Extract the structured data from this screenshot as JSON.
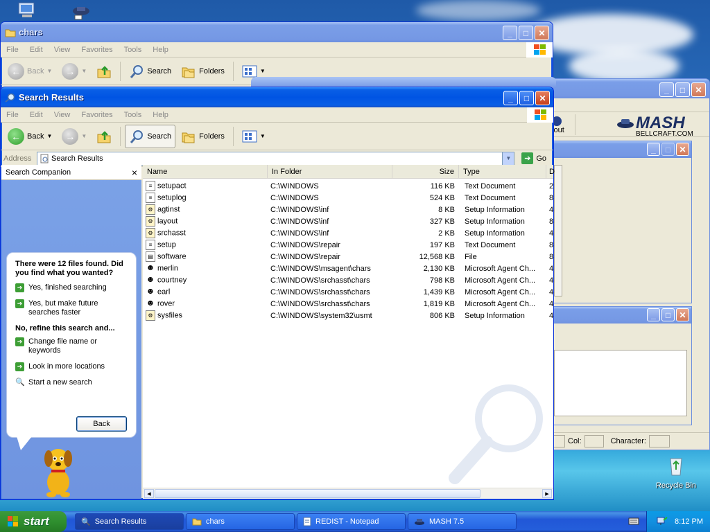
{
  "desktop": {
    "recycle_bin_label": "Recycle Bin"
  },
  "chars_window": {
    "title": "chars",
    "menu": [
      "File",
      "Edit",
      "View",
      "Favorites",
      "Tools",
      "Help"
    ],
    "toolbar": {
      "back": "Back",
      "search": "Search",
      "folders": "Folders"
    }
  },
  "mash_window": {
    "logo_text": "MASH",
    "logo_sub": "BELLCRAFT.COM",
    "partial_label": "yout",
    "status": {
      "col_label": "Col:",
      "character_label": "Character:"
    }
  },
  "search_window": {
    "title": "Search Results",
    "menu": [
      "File",
      "Edit",
      "View",
      "Favorites",
      "Tools",
      "Help"
    ],
    "toolbar": {
      "back": "Back",
      "search": "Search",
      "folders": "Folders"
    },
    "address": {
      "label": "Address",
      "value": "Search Results",
      "go": "Go"
    },
    "companion": {
      "title": "Search Companion",
      "close": "×",
      "found_text": "There were 12 files found. Did you find what you wanted?",
      "opt_yes": "Yes, finished searching",
      "opt_faster": "Yes, but make future searches faster",
      "refine_heading": "No, refine this search and...",
      "opt_change": "Change file name or keywords",
      "opt_more": "Look in more locations",
      "opt_new": "Start a new search",
      "back_button": "Back"
    },
    "columns": [
      "Name",
      "In Folder",
      "Size",
      "Type",
      "D"
    ],
    "files": [
      {
        "name": "setupact",
        "folder": "C:\\WINDOWS",
        "size": "116 KB",
        "type": "Text Document",
        "d": "2",
        "icon": "text-file-icon"
      },
      {
        "name": "setuplog",
        "folder": "C:\\WINDOWS",
        "size": "524 KB",
        "type": "Text Document",
        "d": "8",
        "icon": "text-file-icon"
      },
      {
        "name": "agtinst",
        "folder": "C:\\WINDOWS\\inf",
        "size": "8 KB",
        "type": "Setup Information",
        "d": "4",
        "icon": "setup-file-icon"
      },
      {
        "name": "layout",
        "folder": "C:\\WINDOWS\\inf",
        "size": "327 KB",
        "type": "Setup Information",
        "d": "8",
        "icon": "setup-file-icon"
      },
      {
        "name": "srchasst",
        "folder": "C:\\WINDOWS\\inf",
        "size": "2 KB",
        "type": "Setup Information",
        "d": "4",
        "icon": "setup-file-icon"
      },
      {
        "name": "setup",
        "folder": "C:\\WINDOWS\\repair",
        "size": "197 KB",
        "type": "Text Document",
        "d": "8",
        "icon": "text-file-icon"
      },
      {
        "name": "software",
        "folder": "C:\\WINDOWS\\repair",
        "size": "12,568 KB",
        "type": "File",
        "d": "8",
        "icon": "generic-file-icon"
      },
      {
        "name": "merlin",
        "folder": "C:\\WINDOWS\\msagent\\chars",
        "size": "2,130 KB",
        "type": "Microsoft Agent Ch...",
        "d": "4",
        "icon": "agent-character-icon"
      },
      {
        "name": "courtney",
        "folder": "C:\\WINDOWS\\srchasst\\chars",
        "size": "798 KB",
        "type": "Microsoft Agent Ch...",
        "d": "4",
        "icon": "agent-character-icon"
      },
      {
        "name": "earl",
        "folder": "C:\\WINDOWS\\srchasst\\chars",
        "size": "1,439 KB",
        "type": "Microsoft Agent Ch...",
        "d": "4",
        "icon": "agent-character-icon"
      },
      {
        "name": "rover",
        "folder": "C:\\WINDOWS\\srchasst\\chars",
        "size": "1,819 KB",
        "type": "Microsoft Agent Ch...",
        "d": "4",
        "icon": "agent-character-icon"
      },
      {
        "name": "sysfiles",
        "folder": "C:\\WINDOWS\\system32\\usmt",
        "size": "806 KB",
        "type": "Setup Information",
        "d": "4",
        "icon": "setup-file-icon"
      }
    ]
  },
  "taskbar": {
    "start": "start",
    "buttons": [
      {
        "label": "Search Results"
      },
      {
        "label": "chars"
      },
      {
        "label": "REDIST - Notepad"
      },
      {
        "label": "MASH 7.5"
      }
    ],
    "clock": "8:12 PM"
  }
}
